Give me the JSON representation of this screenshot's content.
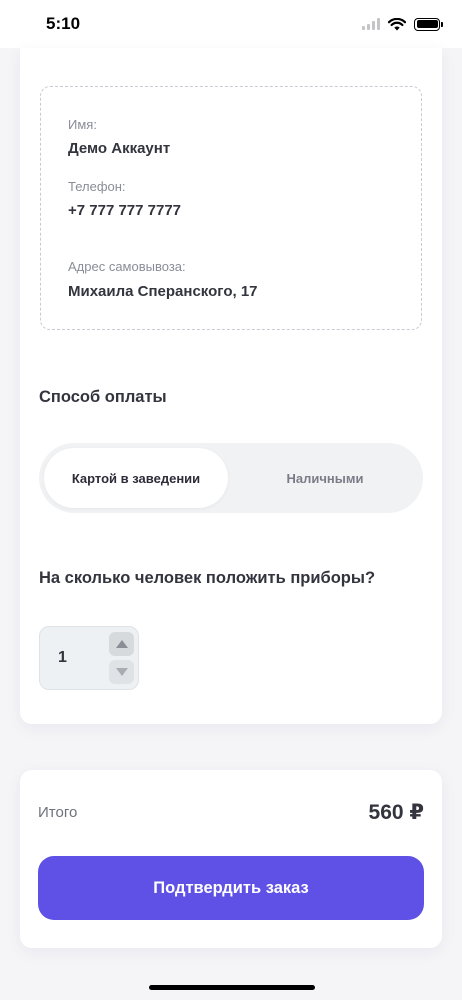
{
  "status_bar": {
    "time": "5:10"
  },
  "contact": {
    "name_label": "Имя:",
    "name_value": "Демо Аккаунт",
    "phone_label": "Телефон:",
    "phone_value": "+7 777 777 7777",
    "address_label": "Адрес самовывоза:",
    "address_value": "Михаила Сперанского, 17"
  },
  "payment": {
    "title": "Способ оплаты",
    "options": [
      {
        "label": "Картой в заведении",
        "selected": true
      },
      {
        "label": "Наличными",
        "selected": false
      }
    ]
  },
  "cutlery": {
    "title": "На сколько человек положить приборы?",
    "value": "1"
  },
  "summary": {
    "total_label": "Итого",
    "total_value": "560 ₽",
    "confirm_label": "Подтвердить заказ"
  },
  "colors": {
    "accent": "#5f51e6",
    "background": "#f5f5f8"
  }
}
